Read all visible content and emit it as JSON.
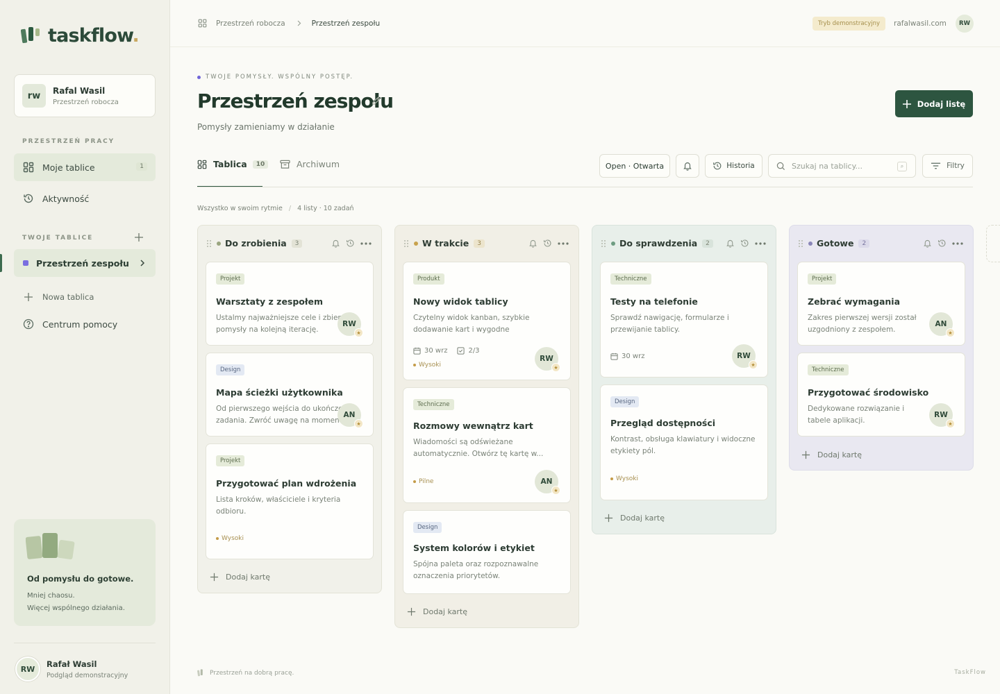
{
  "brand": {
    "name": "taskflow",
    "dot": "."
  },
  "sidebar": {
    "user": {
      "initials": "rw",
      "name": "Rafal Wasil",
      "workspace": "Przestrzeń robocza"
    },
    "workspace_label": "PRZESTRZEŃ PRACY",
    "nav": [
      {
        "label": "Moje tablice",
        "count": "1"
      },
      {
        "label": "Aktywność"
      }
    ],
    "boards_label": "TWOJE TABLICE",
    "boards": [
      {
        "label": "Przestrzeń zespołu"
      }
    ],
    "new_board": "Nowa tablica",
    "help": "Centrum pomocy",
    "promo": {
      "title": "Od pomysłu do gotowe.",
      "line1": "Mniej chaosu.",
      "line2": "Więcej wspólnego działania."
    },
    "bottom_user": {
      "initials": "RW",
      "name": "Rafał Wasil",
      "role": "Podgląd demonstracyjny"
    }
  },
  "topbar": {
    "breadcrumb": [
      "Przestrzeń robocza",
      "Przestrzeń zespołu"
    ],
    "demo_badge": "Tryb demonstracyjny",
    "site": "rafalwasil.com",
    "avatar": "RW"
  },
  "header": {
    "eyebrow": "TWOJE POMYSŁY. WSPÓLNY POSTĘP.",
    "title": "Przestrzeń zespołu",
    "subtitle": "Pomysły zamieniamy w działanie",
    "add_list": "Dodaj listę"
  },
  "tabs": [
    {
      "label": "Tablica",
      "count": "10"
    },
    {
      "label": "Archiwum"
    }
  ],
  "toolbar": {
    "status": "Open · Otwarta",
    "history": "Historia",
    "search_placeholder": "Szukaj na tablicy...",
    "filters": "Filtry"
  },
  "summary": {
    "left": "Wszystko w swoim rytmie",
    "right": "4 listy · 10 zadań"
  },
  "add_card": "Dodaj kartę",
  "columns": [
    {
      "title": "Do zrobienia",
      "count": "3",
      "dot": "#9aa57f",
      "cards": [
        {
          "tag": "Projekt",
          "title": "Warsztaty z zespołem",
          "desc": "Ustalmy najważniejsze cele i zbierzmy pomysły na kolejną iterację.",
          "avatar": "RW"
        },
        {
          "tag": "Design",
          "title": "Mapa ścieżki użytkownika",
          "desc": "Od pierwszego wejścia do ukończenia zadania. Zwróć uwagę na momenty.",
          "avatar": "AN"
        },
        {
          "tag": "Projekt",
          "title": "Przygotować plan wdrożenia",
          "desc": "Lista kroków, właściciele i kryteria odbioru.",
          "priority": "Wysoki"
        }
      ]
    },
    {
      "title": "W trakcie",
      "count": "3",
      "dot": "#c8a24d",
      "cards": [
        {
          "tag": "Produkt",
          "title": "Nowy widok tablicy",
          "desc": "Czytelny widok kanban, szybkie dodawanie kart i wygodne przenoszenie...",
          "date": "30 wrz",
          "checks": "2/3",
          "priority": "Wysoki",
          "avatar": "RW"
        },
        {
          "tag": "Techniczne",
          "title": "Rozmowy wewnątrz kart",
          "desc": "Wiadomości są odświeżane automatycznie. Otwórz tę kartę w...",
          "priority": "Pilne",
          "avatar": "AN"
        },
        {
          "tag": "Design",
          "title": "System kolorów i etykiet",
          "desc": "Spójna paleta oraz rozpoznawalne oznaczenia priorytetów."
        }
      ]
    },
    {
      "title": "Do sprawdzenia",
      "count": "2",
      "dot": "#6e9c82",
      "cards": [
        {
          "tag": "Techniczne",
          "title": "Testy na telefonie",
          "desc": "Sprawdź nawigację, formularze i przewijanie tablicy.",
          "date": "30 wrz",
          "avatar": "RW"
        },
        {
          "tag": "Design",
          "title": "Przegląd dostępności",
          "desc": "Kontrast, obsługa klawiatury i widoczne etykiety pól.",
          "priority": "Wysoki"
        }
      ]
    },
    {
      "title": "Gotowe",
      "count": "2",
      "dot": "#8a86b8",
      "cards": [
        {
          "tag": "Projekt",
          "title": "Zebrać wymagania",
          "desc": "Zakres pierwszej wersji został uzgodniony z zespołem.",
          "avatar": "AN"
        },
        {
          "tag": "Techniczne",
          "title": "Przygotować środowisko",
          "desc": "Dedykowane rozwiązanie i tabele aplikacji.",
          "avatar": "RW"
        }
      ]
    }
  ],
  "footer": {
    "left": "Przestrzeń na dobrą pracę.",
    "right": "TaskFlow"
  },
  "colors": {
    "accent": "#2d5540",
    "todo_bg": "#f1f1ea",
    "progress_bg": "#f1efe6",
    "review_bg": "#e8efea",
    "done_bg": "#e9e8f1"
  }
}
